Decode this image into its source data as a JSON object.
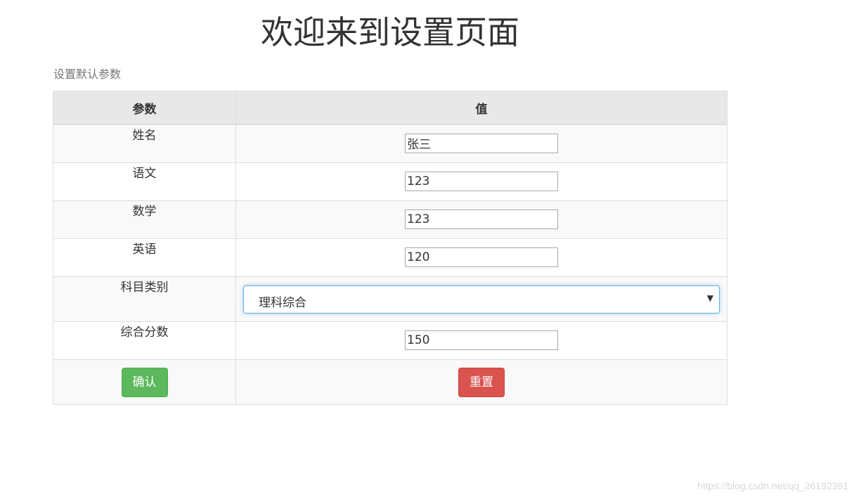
{
  "page": {
    "title": "欢迎来到设置页面",
    "caption": "设置默认参数"
  },
  "table": {
    "headers": {
      "param": "参数",
      "value": "值"
    },
    "rows": [
      {
        "label": "姓名",
        "value": "张三"
      },
      {
        "label": "语文",
        "value": "123"
      },
      {
        "label": "数学",
        "value": "123"
      },
      {
        "label": "英语",
        "value": "120"
      },
      {
        "label": "科目类别",
        "selected": "理科综合"
      },
      {
        "label": "综合分数",
        "value": "150"
      }
    ],
    "actions": {
      "confirm": "确认",
      "reset": "重置"
    }
  },
  "watermark": "https://blog.csdn.net/qq_26192391",
  "colors": {
    "confirm": "#5cb85c",
    "reset": "#d9534f",
    "focus": "#66afe9"
  }
}
